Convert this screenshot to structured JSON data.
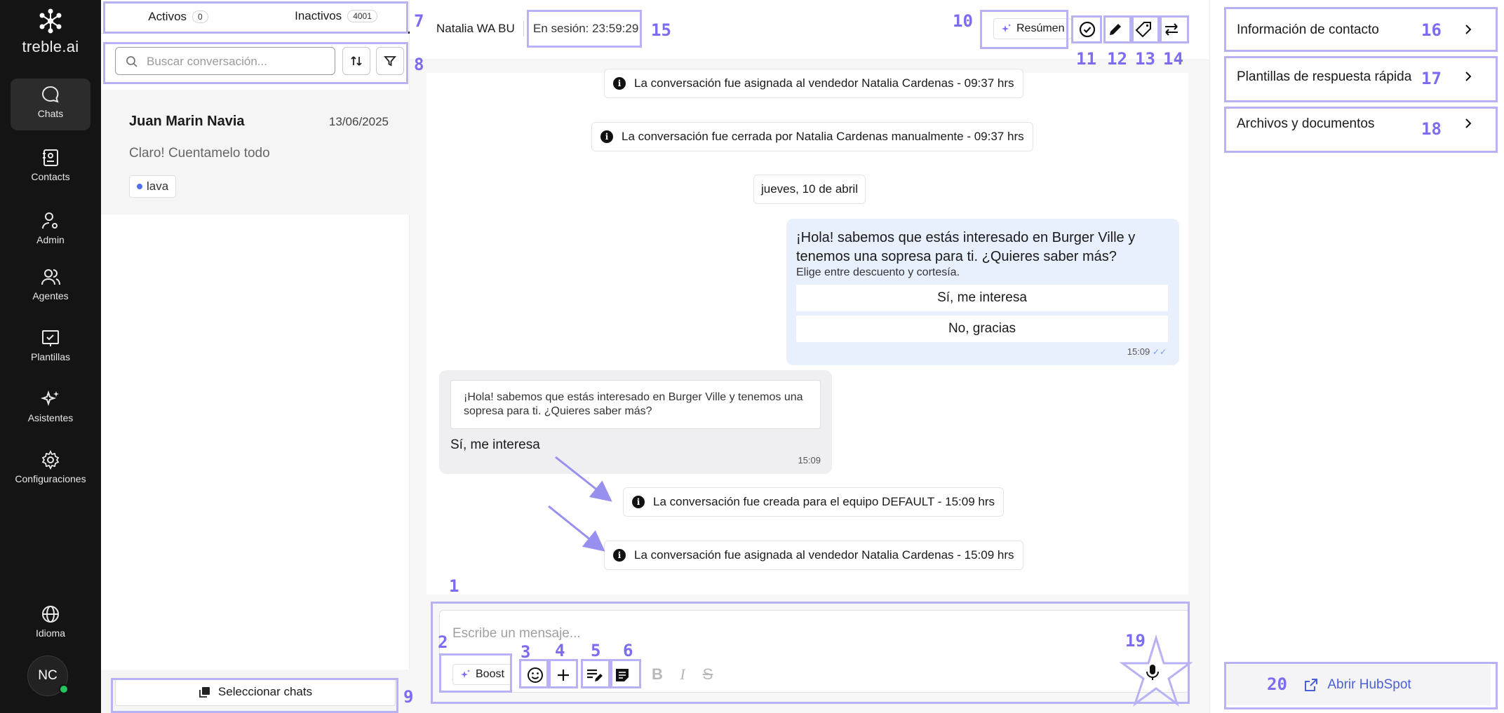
{
  "brand": {
    "name": "treble.ai"
  },
  "nav": {
    "items": [
      {
        "label": "Chats",
        "icon": "chat-bubble-icon",
        "active": true
      },
      {
        "label": "Contacts",
        "icon": "contacts-book-icon"
      },
      {
        "label": "Admin",
        "icon": "admin-user-gear-icon"
      },
      {
        "label": "Agentes",
        "icon": "agents-users-icon"
      },
      {
        "label": "Plantillas",
        "icon": "template-check-icon"
      },
      {
        "label": "Asistentes",
        "icon": "sparkles-icon"
      },
      {
        "label": "Configuraciones",
        "icon": "gear-icon"
      }
    ],
    "language": {
      "label": "Idioma",
      "icon": "globe-icon"
    },
    "avatar": {
      "initials": "NC",
      "status_color": "#22c55e"
    }
  },
  "conversation_list": {
    "tabs": [
      {
        "label": "Activos",
        "count": "0"
      },
      {
        "label": "Inactivos",
        "count": "4001",
        "selected": true
      }
    ],
    "search": {
      "placeholder": "Buscar conversación...",
      "value": ""
    },
    "conversations": [
      {
        "name": "Juan Marin Navia",
        "date": "13/06/2025",
        "preview": "Claro! Cuentamelo todo",
        "tag": "lava",
        "tag_color": "#4f6ef7"
      }
    ],
    "select_button_label": "Seleccionar chats"
  },
  "chat": {
    "header": {
      "agent_name": "Natalia WA BU",
      "session": "En sesión: 23:59:29",
      "summary_button": "Resúmen",
      "actions": [
        "check-circle-icon",
        "pencil-icon",
        "tag-icon",
        "transfer-arrows-icon"
      ]
    },
    "messages": {
      "sys1": "La conversación fue asignada al vendedor Natalia Cardenas - 09:37 hrs",
      "sys2": "La conversación fue cerrada por Natalia Cardenas manualmente - 09:37 hrs",
      "date_separator": "jueves, 10 de abril",
      "outgoing": {
        "text": "¡Hola! sabemos que estás interesado en Burger Ville y tenemos una sopresa para ti. ¿Quieres saber más?",
        "subtext": "Elige entre descuento y cortesía.",
        "options": [
          "Sí, me interesa",
          "No, gracias"
        ],
        "time": "15:09",
        "status": "✓✓"
      },
      "incoming": {
        "quoted": "¡Hola! sabemos que estás interesado en Burger Ville y tenemos una sopresa para ti. ¿Quieres saber más?",
        "text": "Sí, me interesa",
        "time": "15:09"
      },
      "sys3": "La conversación fue creada para el equipo DEFAULT - 15:09 hrs",
      "sys4": "La conversación fue asignada al vendedor Natalia Cardenas - 15:09 hrs"
    },
    "composer": {
      "placeholder": "Escribe un mensaje...",
      "boost_label": "Boost",
      "tools": [
        "emoji-icon",
        "plus-icon",
        "quick-reply-icon",
        "note-icon"
      ],
      "format": {
        "bold": "B",
        "italic": "I",
        "strike": "S"
      }
    }
  },
  "right_panel": {
    "sections": [
      "Información de contacto",
      "Plantillas de respuesta rápida",
      "Archivos y documentos"
    ],
    "hubspot_label": "Abrir HubSpot"
  },
  "annotations": {
    "color": "#7c6cf0",
    "numbers": [
      "1",
      "2",
      "3",
      "4",
      "5",
      "6",
      "7",
      "8",
      "9",
      "10",
      "11",
      "12",
      "13",
      "14",
      "15",
      "16",
      "17",
      "18",
      "19",
      "20"
    ]
  }
}
